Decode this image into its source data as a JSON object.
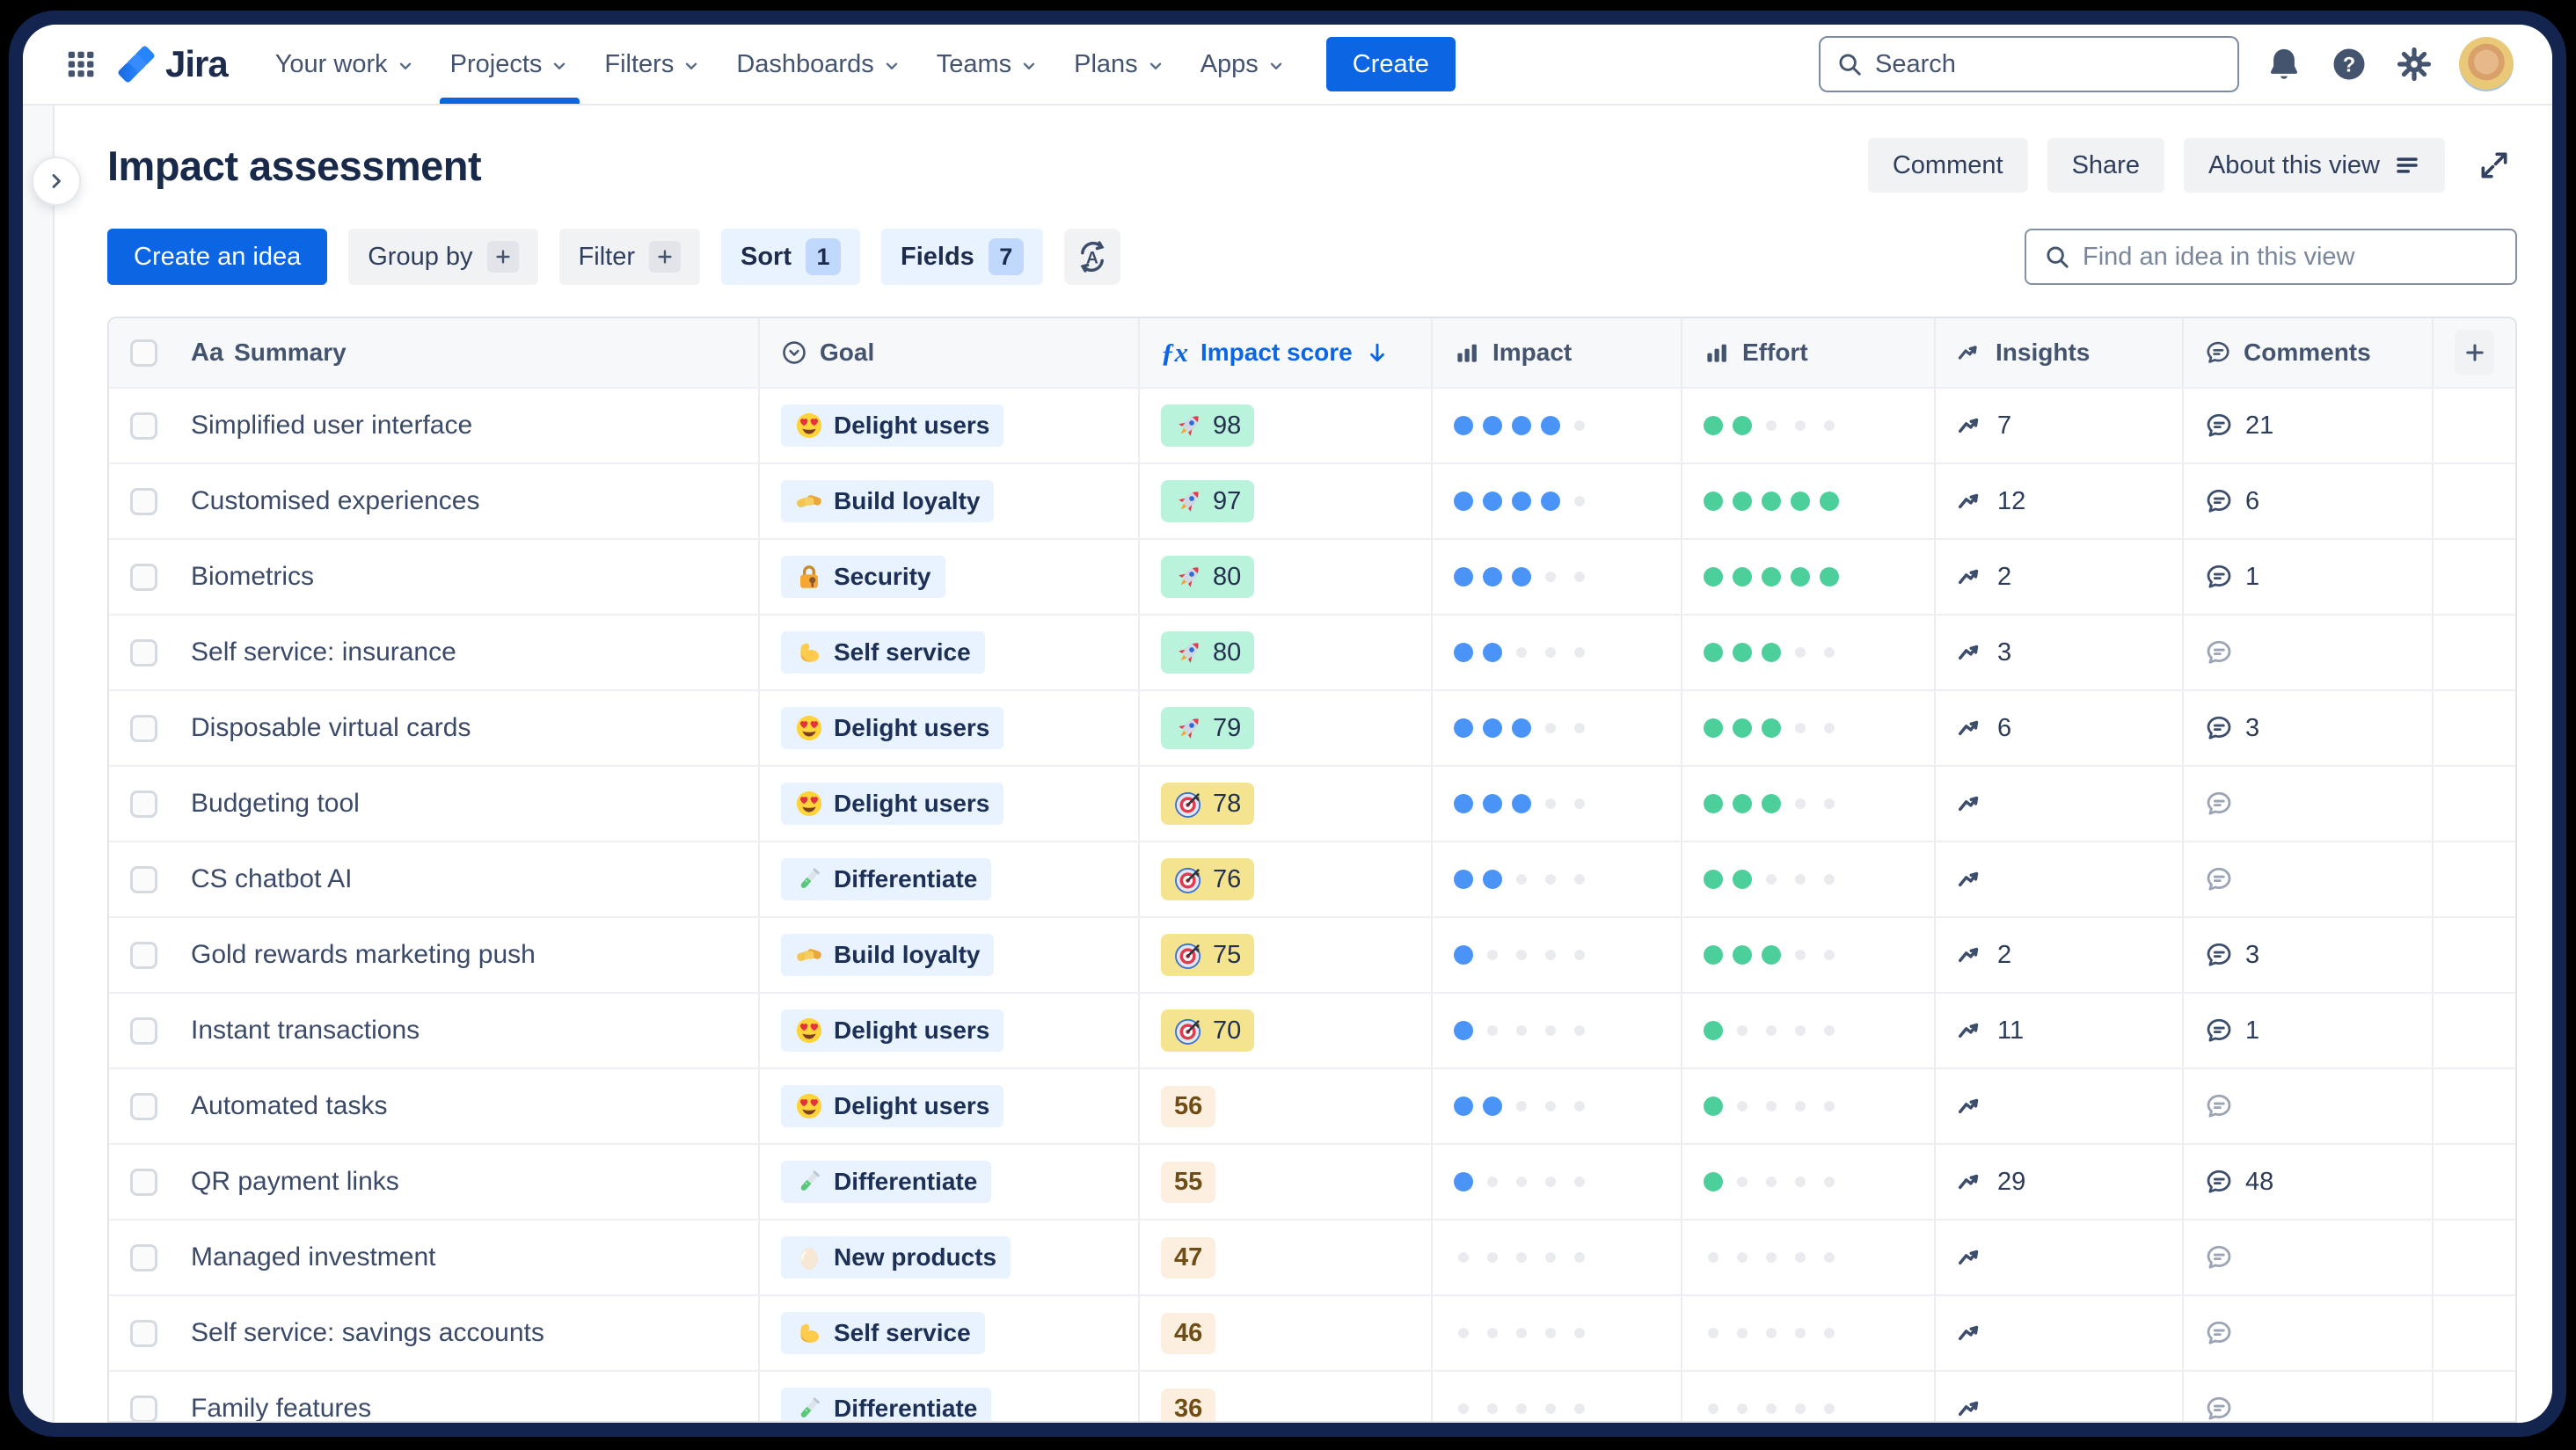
{
  "nav": {
    "logo_text": "Jira",
    "items": [
      {
        "label": "Your work",
        "active": false
      },
      {
        "label": "Projects",
        "active": true
      },
      {
        "label": "Filters",
        "active": false
      },
      {
        "label": "Dashboards",
        "active": false
      },
      {
        "label": "Teams",
        "active": false
      },
      {
        "label": "Plans",
        "active": false
      },
      {
        "label": "Apps",
        "active": false
      }
    ],
    "create_label": "Create",
    "search_placeholder": "Search"
  },
  "header": {
    "title": "Impact assessment",
    "comment_label": "Comment",
    "share_label": "Share",
    "about_label": "About this view"
  },
  "toolbar": {
    "create_idea_label": "Create an idea",
    "group_by_label": "Group by",
    "filter_label": "Filter",
    "sort_label": "Sort",
    "sort_count": "1",
    "fields_label": "Fields",
    "fields_count": "7",
    "find_placeholder": "Find an idea in this view"
  },
  "table": {
    "columns": [
      {
        "label": "Summary",
        "icon": "text-style-icon"
      },
      {
        "label": "Goal",
        "icon": "goal-status-icon"
      },
      {
        "label": "Impact score",
        "icon": "formula-icon",
        "sorted": "desc"
      },
      {
        "label": "Impact",
        "icon": "bar-chart-icon"
      },
      {
        "label": "Effort",
        "icon": "bar-chart-icon"
      },
      {
        "label": "Insights",
        "icon": "trend-icon"
      },
      {
        "label": "Comments",
        "icon": "comment-bubble-icon"
      }
    ],
    "rating_scale": 5,
    "rows": [
      {
        "summary": "Simplified user interface",
        "goal": {
          "label": "Delight users",
          "icon": "heart-eyes"
        },
        "score": {
          "value": 98,
          "tier": "green",
          "icon": "rocket"
        },
        "impact": 4,
        "effort": 2,
        "insights": 7,
        "comments": 21
      },
      {
        "summary": "Customised experiences",
        "goal": {
          "label": "Build loyalty",
          "icon": "handshake"
        },
        "score": {
          "value": 97,
          "tier": "green",
          "icon": "rocket"
        },
        "impact": 4,
        "effort": 5,
        "insights": 12,
        "comments": 6
      },
      {
        "summary": "Biometrics",
        "goal": {
          "label": "Security",
          "icon": "lock-key"
        },
        "score": {
          "value": 80,
          "tier": "green",
          "icon": "rocket"
        },
        "impact": 3,
        "effort": 5,
        "insights": 2,
        "comments": 1
      },
      {
        "summary": "Self service: insurance",
        "goal": {
          "label": "Self service",
          "icon": "biceps"
        },
        "score": {
          "value": 80,
          "tier": "green",
          "icon": "rocket"
        },
        "impact": 2,
        "effort": 3,
        "insights": 3,
        "comments": null
      },
      {
        "summary": "Disposable virtual cards",
        "goal": {
          "label": "Delight users",
          "icon": "heart-eyes"
        },
        "score": {
          "value": 79,
          "tier": "green",
          "icon": "rocket"
        },
        "impact": 3,
        "effort": 3,
        "insights": 6,
        "comments": 3
      },
      {
        "summary": "Budgeting tool",
        "goal": {
          "label": "Delight users",
          "icon": "heart-eyes"
        },
        "score": {
          "value": 78,
          "tier": "yellow",
          "icon": "target"
        },
        "impact": 3,
        "effort": 3,
        "insights": null,
        "comments": null
      },
      {
        "summary": "CS chatbot AI",
        "goal": {
          "label": "Differentiate",
          "icon": "test-tube"
        },
        "score": {
          "value": 76,
          "tier": "yellow",
          "icon": "target"
        },
        "impact": 2,
        "effort": 2,
        "insights": null,
        "comments": null
      },
      {
        "summary": "Gold rewards marketing push",
        "goal": {
          "label": "Build loyalty",
          "icon": "handshake"
        },
        "score": {
          "value": 75,
          "tier": "yellow",
          "icon": "target"
        },
        "impact": 1,
        "effort": 3,
        "insights": 2,
        "comments": 3
      },
      {
        "summary": "Instant transactions",
        "goal": {
          "label": "Delight users",
          "icon": "heart-eyes"
        },
        "score": {
          "value": 70,
          "tier": "yellow",
          "icon": "target"
        },
        "impact": 1,
        "effort": 1,
        "insights": 11,
        "comments": 1
      },
      {
        "summary": "Automated tasks",
        "goal": {
          "label": "Delight users",
          "icon": "heart-eyes"
        },
        "score": {
          "value": 56,
          "tier": "plain",
          "icon": null
        },
        "impact": 2,
        "effort": 1,
        "insights": null,
        "comments": null
      },
      {
        "summary": "QR payment links",
        "goal": {
          "label": "Differentiate",
          "icon": "test-tube"
        },
        "score": {
          "value": 55,
          "tier": "plain",
          "icon": null
        },
        "impact": 1,
        "effort": 1,
        "insights": 29,
        "comments": 48
      },
      {
        "summary": "Managed investment",
        "goal": {
          "label": "New products",
          "icon": "egg"
        },
        "score": {
          "value": 47,
          "tier": "plain",
          "icon": null
        },
        "impact": 0,
        "effort": 0,
        "insights": null,
        "comments": null
      },
      {
        "summary": "Self service: savings accounts",
        "goal": {
          "label": "Self service",
          "icon": "biceps"
        },
        "score": {
          "value": 46,
          "tier": "plain",
          "icon": null
        },
        "impact": 0,
        "effort": 0,
        "insights": null,
        "comments": null
      },
      {
        "summary": "Family features",
        "goal": {
          "label": "Differentiate",
          "icon": "test-tube"
        },
        "score": {
          "value": 36,
          "tier": "plain",
          "icon": null
        },
        "impact": 0,
        "effort": 0,
        "insights": null,
        "comments": null
      }
    ]
  },
  "colors": {
    "accent": "#0C66E4",
    "window_frame": "#13244E",
    "dot_blue": "#4A94F8",
    "dot_green": "#4DCF9C",
    "tier_green": "#BAF3DB",
    "tier_yellow": "#F5E48F",
    "tier_plain": "#FCEFDF",
    "tier_plain_text": "#6E4D16",
    "chip_blue": "#E9F2FF"
  }
}
